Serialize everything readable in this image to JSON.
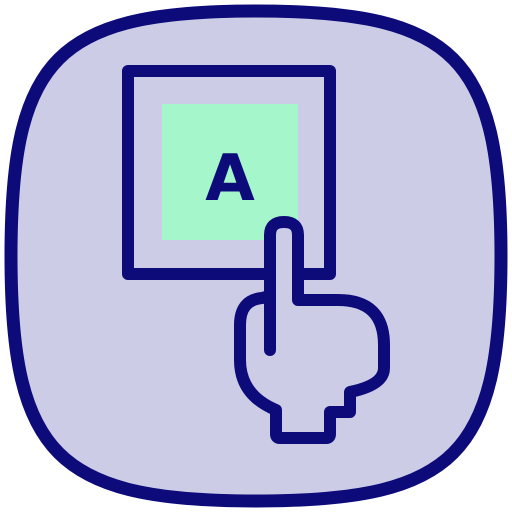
{
  "icon": {
    "name": "touch-button-icon",
    "button_letter": "A"
  },
  "colors": {
    "outline": "#0d0b7a",
    "background_fill": "#cccce6",
    "button_fill": "#a5f7cb",
    "hand_fill": "#cccce6"
  }
}
